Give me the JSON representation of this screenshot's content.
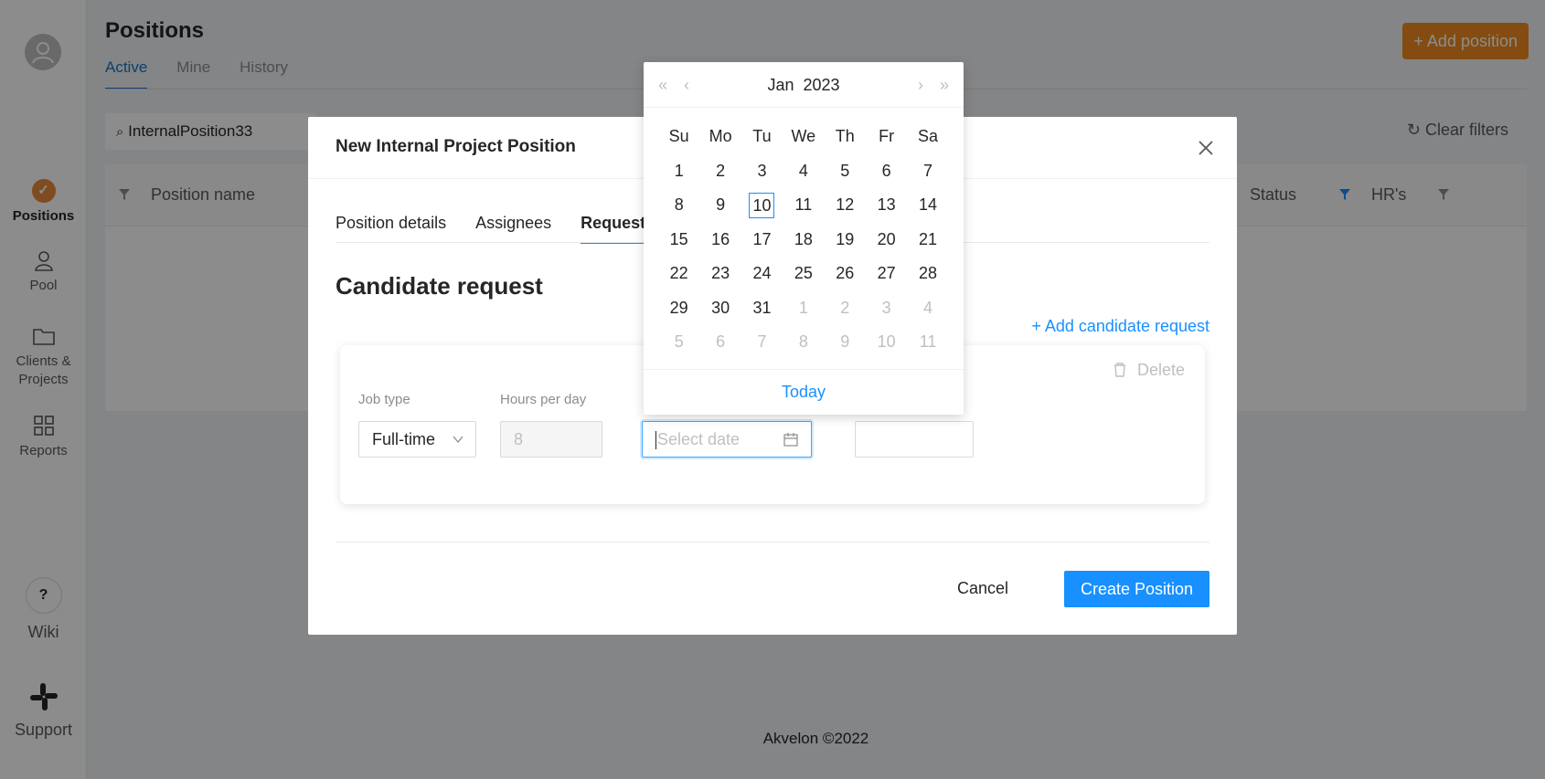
{
  "sidebar": {
    "items": [
      {
        "label": "Positions"
      },
      {
        "label": "Pool"
      },
      {
        "label": "Clients &"
      },
      {
        "label": "Projects"
      },
      {
        "label": "Reports"
      },
      {
        "label": "Wiki"
      },
      {
        "label": "Support"
      }
    ],
    "wiki_symbol": "?",
    "check_symbol": "✓"
  },
  "page": {
    "title": "Positions",
    "tabs": [
      "Active",
      "Mine",
      "History"
    ],
    "add_position_label": "+ Add position",
    "search_value": "InternalPosition33",
    "clear_filters_label": "Clear filters",
    "columns": [
      "Position name",
      "Status",
      "HR's"
    ],
    "footer": "Akvelon ©2022"
  },
  "modal": {
    "title": "New Internal Project Position",
    "tabs": [
      "Position details",
      "Assignees",
      "Requests"
    ],
    "section_title": "Candidate request",
    "add_request_label": "+ Add candidate request",
    "delete_label": "Delete",
    "fields": {
      "job_type_label": "Job type",
      "job_type_value": "Full-time",
      "hours_label": "Hours per day",
      "hours_value": "8",
      "date_placeholder": "Select date"
    },
    "cancel_label": "Cancel",
    "create_label": "Create Position"
  },
  "calendar": {
    "month": "Jan",
    "year": "2023",
    "weekdays": [
      "Su",
      "Mo",
      "Tu",
      "We",
      "Th",
      "Fr",
      "Sa"
    ],
    "rows": [
      [
        "1",
        "2",
        "3",
        "4",
        "5",
        "6",
        "7"
      ],
      [
        "8",
        "9",
        "10",
        "11",
        "12",
        "13",
        "14"
      ],
      [
        "15",
        "16",
        "17",
        "18",
        "19",
        "20",
        "21"
      ],
      [
        "22",
        "23",
        "24",
        "25",
        "26",
        "27",
        "28"
      ],
      [
        "29",
        "30",
        "31",
        "1",
        "2",
        "3",
        "4"
      ],
      [
        "5",
        "6",
        "7",
        "8",
        "9",
        "10",
        "11"
      ]
    ],
    "today_label": "Today",
    "nav": {
      "prev_year": "«",
      "prev_month": "‹",
      "next_month": "›",
      "next_year": "»"
    },
    "colors": {
      "accent": "#1890ff",
      "muted": "#bfbfbf"
    }
  }
}
